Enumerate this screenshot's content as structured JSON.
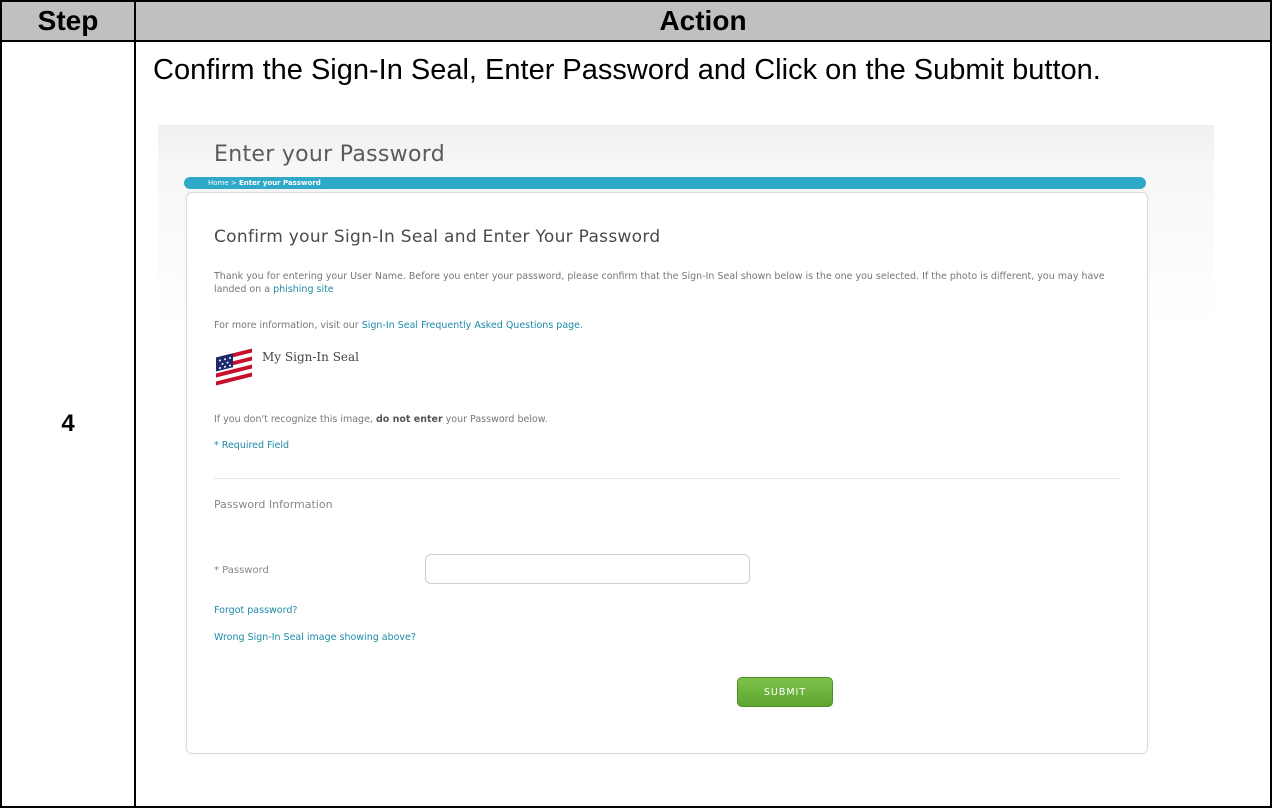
{
  "table": {
    "headers": {
      "step": "Step",
      "action": "Action"
    },
    "step_number": "4",
    "instruction": "Confirm the Sign-In Seal, Enter Password and Click on the Submit button."
  },
  "screen": {
    "page_title": "Enter your Password",
    "breadcrumb": {
      "home": "Home",
      "separator": ">",
      "current": "Enter your Password"
    },
    "panel_title": "Confirm your Sign-In Seal and Enter Your Password",
    "intro_text": "Thank you for entering your User Name. Before you enter your password, please confirm that the Sign-In Seal shown below is the one you selected. If the photo is different, you may have landed on a",
    "phishing_link": "phishing site",
    "more_info_text": "For more information, visit our",
    "faq_link": "Sign-In Seal Frequently Asked Questions page.",
    "seal_label": "My Sign-In Seal",
    "warning_prefix": "If you don't recognize this image,",
    "warning_bold": "do not enter",
    "warning_suffix": "your Password below.",
    "required_note": "* Required Field",
    "section_label": "Password Information",
    "password_label": "* Password",
    "password_value": "",
    "forgot_link": "Forgot password?",
    "wrong_seal_link": "Wrong Sign-In Seal image showing above?",
    "submit_label": "SUBMIT"
  },
  "colors": {
    "header_bg": "#c0c0c0",
    "breadcrumb_bar": "#2fa9c8",
    "link": "#1e8aa8",
    "submit_green": "#6ab53a"
  }
}
